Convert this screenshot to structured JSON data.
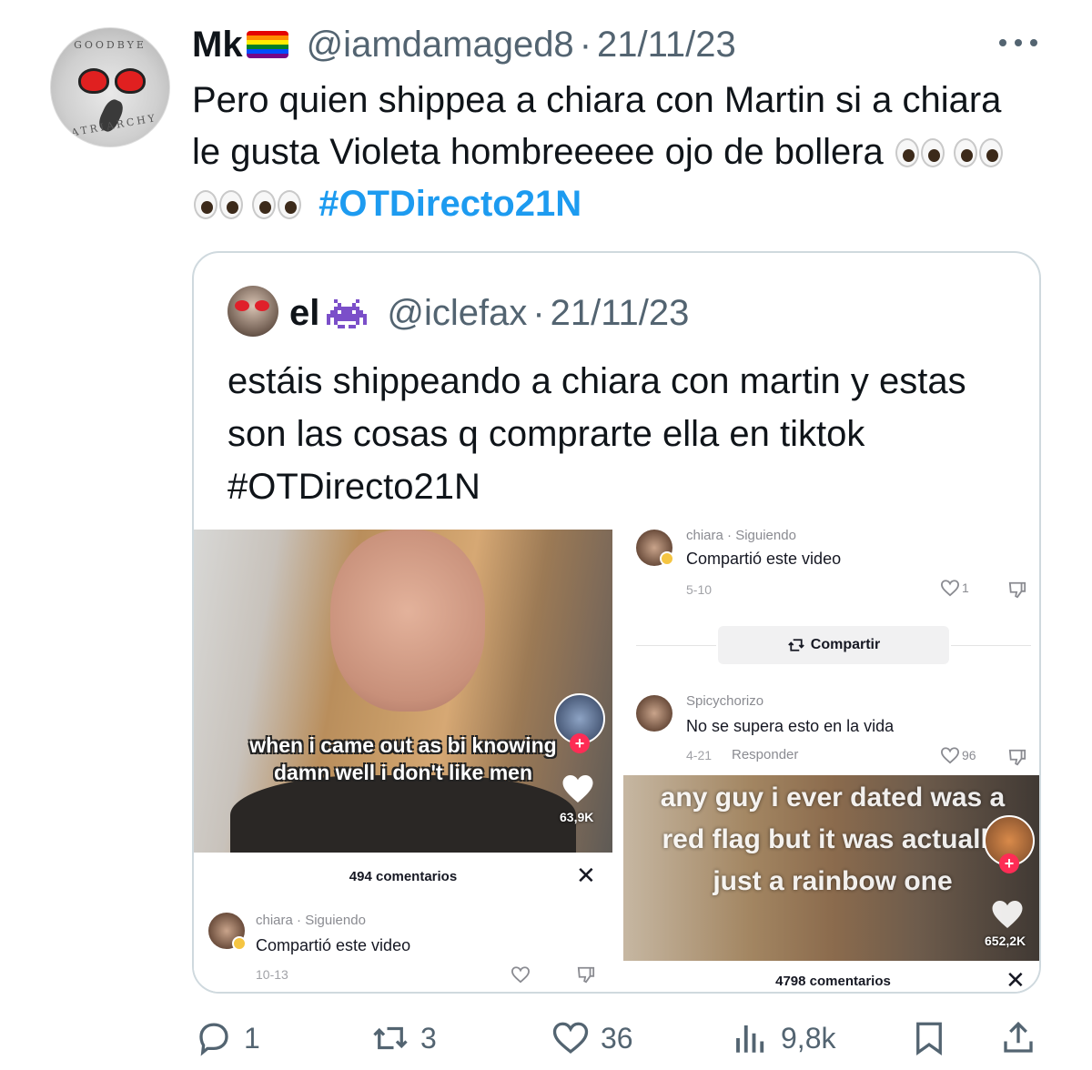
{
  "tweet": {
    "author": {
      "display_name": "Mk",
      "handle": "@iamdamaged8",
      "date": "21/11/23",
      "flag_icon": "rainbow-flag-icon"
    },
    "text_before": "Pero quien shippea a chiara con Martin si a chiara le gusta Violeta hombreeeee ojo de bollera",
    "emoji": "eyes-emoji",
    "hashtag": "#OTDirecto21N",
    "avatar_shirt_text_top": "GOODBYE",
    "avatar_shirt_text_bottom": "PATRIARCHY",
    "separator": "·"
  },
  "quote": {
    "author": {
      "display_name": "el",
      "handle": "@iclefax",
      "date": "21/11/23",
      "emoji_icon": "alien-monster-icon"
    },
    "text": "estáis shippeando a chiara con martin y estas son las cosas q comprarte ella en tiktok #OTDirecto21N"
  },
  "media": {
    "left": {
      "caption": "when i came out as bi knowing damn well i don't like men",
      "likes": "63,9K",
      "comments_title": "494 comentarios",
      "comment": {
        "user": "chiara",
        "follow": "Siguiendo",
        "text": "Compartió este video",
        "date": "10-13"
      }
    },
    "right": {
      "comment1": {
        "user": "chiara",
        "follow": "Siguiendo",
        "text": "Compartió este video",
        "date": "5-10",
        "likes": "1"
      },
      "share_label": "Compartir",
      "comment2": {
        "user": "Spicychorizo",
        "text": "No se supera esto en la vida",
        "date": "4-21",
        "reply": "Responder",
        "likes": "96"
      },
      "caption": "any guy i ever dated was a red flag but it was actually just a rainbow one",
      "likes": "652,2K",
      "comments_title": "4798 comentarios"
    }
  },
  "actions": {
    "replies": "1",
    "retweets": "3",
    "likes": "36",
    "views": "9,8k"
  },
  "colors": {
    "accent": "#1d9bf0",
    "muted": "#536471",
    "tiktok_red": "#fe2c55"
  }
}
